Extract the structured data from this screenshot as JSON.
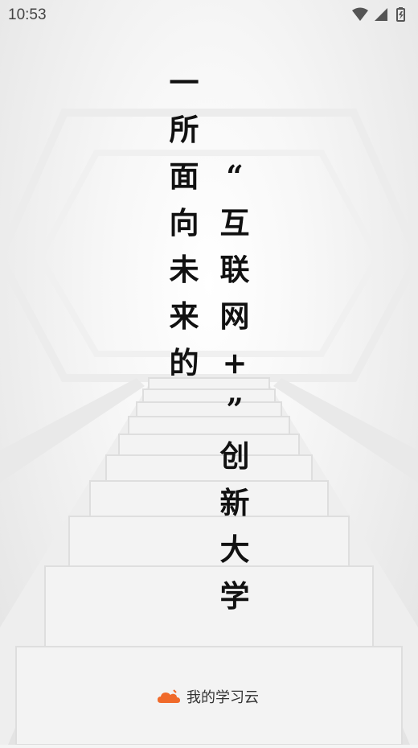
{
  "status_bar": {
    "time": "10:53"
  },
  "slogan": {
    "left_column": [
      "一",
      "所",
      "面",
      "向",
      "未",
      "来",
      "的"
    ],
    "right_column": [
      "“",
      "互",
      "联",
      "网",
      "+",
      "”",
      "创",
      "新",
      "大",
      "学"
    ]
  },
  "brand": {
    "name": "我的学习云",
    "icon": "cloud-logo-icon",
    "accent": "#f06a2a"
  }
}
